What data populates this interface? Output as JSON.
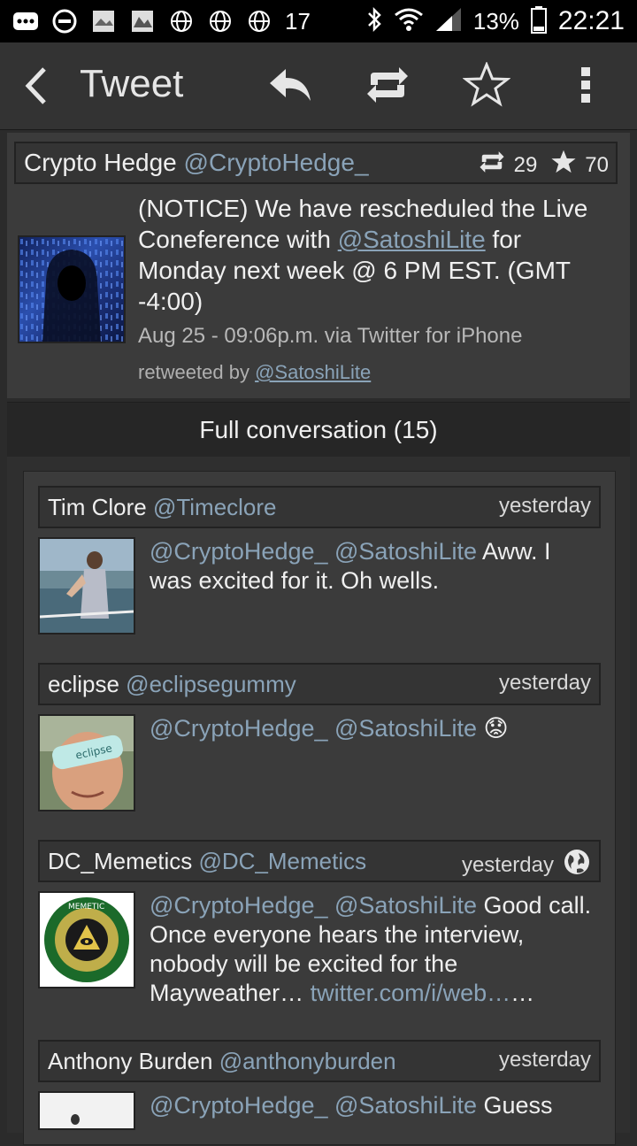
{
  "status_bar": {
    "temperature": "17",
    "battery": "13%",
    "time": "22:21"
  },
  "action_bar": {
    "title": "Tweet",
    "icons": [
      "back-chevron-icon",
      "reply-icon",
      "retweet-icon",
      "star-icon",
      "overflow-menu-icon"
    ]
  },
  "tweet": {
    "name": "Crypto Hedge",
    "handle": "@CryptoHedge_",
    "retweets": "29",
    "favorites": "70",
    "text_before": "(NOTICE) We have rescheduled the Live Coneference with ",
    "text_mention": "@SatoshiLite",
    "text_after": " for Monday next week @ 6 PM EST. (GMT -4:00)",
    "meta": "Aug 25 - 09:06p.m. via Twitter for iPhone",
    "retweeted_by_label": "retweeted by ",
    "retweeted_by": "@SatoshiLite"
  },
  "conversation": {
    "label": "Full conversation (15)",
    "replies": [
      {
        "name": "Tim Clore",
        "handle": "@Timeclore",
        "time": "yesterday",
        "mentions": "@CryptoHedge_ @SatoshiLite",
        "text": " Aww. I was excited for it. Oh wells.",
        "link": ""
      },
      {
        "name": "eclipse",
        "handle": "@eclipsegummy",
        "time": "yesterday",
        "mentions": "@CryptoHedge_ @SatoshiLite",
        "text": " 😟",
        "link": ""
      },
      {
        "name": "DC_Memetics",
        "handle": "@DC_Memetics",
        "time": "yesterday",
        "mentions": "@CryptoHedge_ @SatoshiLite",
        "text": " Good call. Once everyone hears the interview, nobody will be excited for the Mayweather… ",
        "link": "twitter.com/i/web…",
        "suffix": "…"
      },
      {
        "name": "Anthony Burden",
        "handle": "@anthonyburden",
        "time": "yesterday",
        "mentions": "@CryptoHedge_ @SatoshiLite",
        "text": " Guess",
        "link": ""
      }
    ]
  },
  "colors": {
    "background": "#2b2b2b",
    "card": "#3b3b3b",
    "link": "#8aa3b8",
    "statusbar": "#000000"
  }
}
